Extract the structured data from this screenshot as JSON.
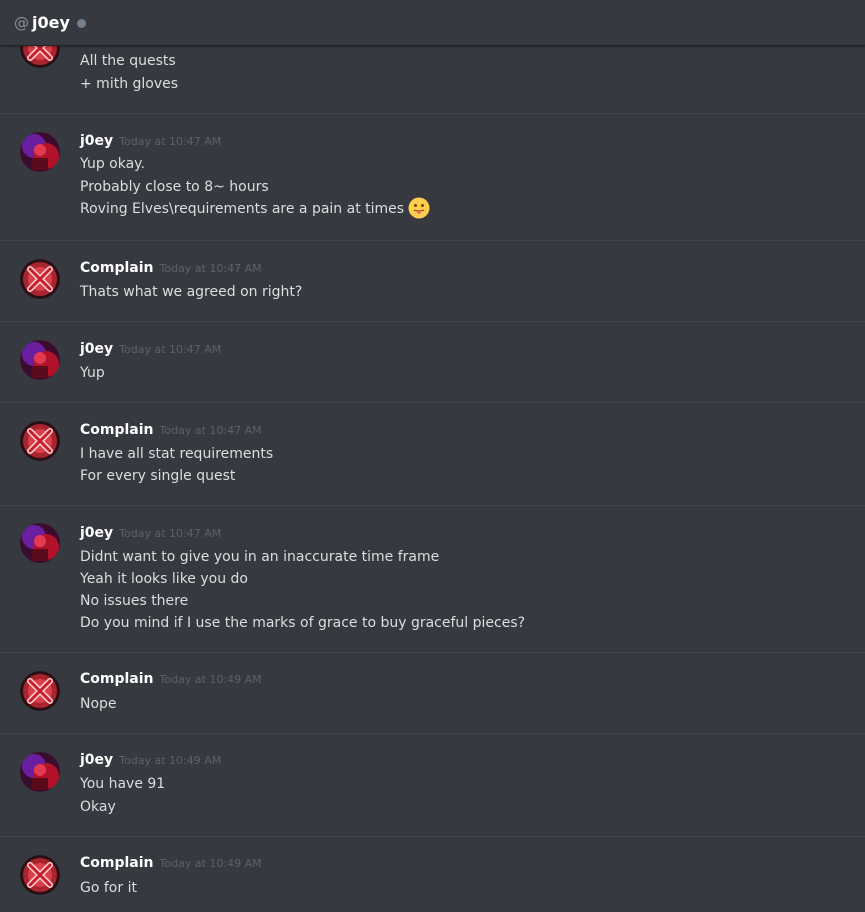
{
  "header": {
    "at_symbol": "@",
    "name": "j0ey"
  },
  "messages": [
    {
      "author": "",
      "time": "",
      "lines": [
        "All the quests",
        "+ mith gloves"
      ]
    },
    {
      "author": "j0ey",
      "time": "Today at 10:47 AM",
      "lines": [
        "Yup okay.",
        "Probably close to 8~ hours",
        "Roving Elves\\requirements are a pain at times"
      ],
      "emoji": "stuck-out-tongue-emoji"
    },
    {
      "author": "Complain",
      "time": "Today at 10:47 AM",
      "lines": [
        "Thats what we agreed on right?"
      ]
    },
    {
      "author": "j0ey",
      "time": "Today at 10:47 AM",
      "lines": [
        "Yup"
      ]
    },
    {
      "author": "Complain",
      "time": "Today at 10:47 AM",
      "lines": [
        "I have all stat requirements",
        "For every single quest"
      ]
    },
    {
      "author": "j0ey",
      "time": "Today at 10:47 AM",
      "lines": [
        "Didnt want to give you in an inaccurate time frame",
        "Yeah it looks like you do",
        "No issues there",
        "Do you mind if I use the marks of grace to buy graceful pieces?"
      ]
    },
    {
      "author": "Complain",
      "time": "Today at 10:49 AM",
      "lines": [
        "Nope"
      ]
    },
    {
      "author": "j0ey",
      "time": "Today at 10:49 AM",
      "lines": [
        "You have 91",
        "Okay"
      ]
    },
    {
      "author": "Complain",
      "time": "Today at 10:49 AM",
      "lines": [
        "Go for it"
      ]
    }
  ],
  "colors": {
    "background": "#36393f",
    "username": "#ffffff",
    "timestamp": "#5d6168",
    "text": "#dcddde",
    "divider": "#40444b"
  }
}
